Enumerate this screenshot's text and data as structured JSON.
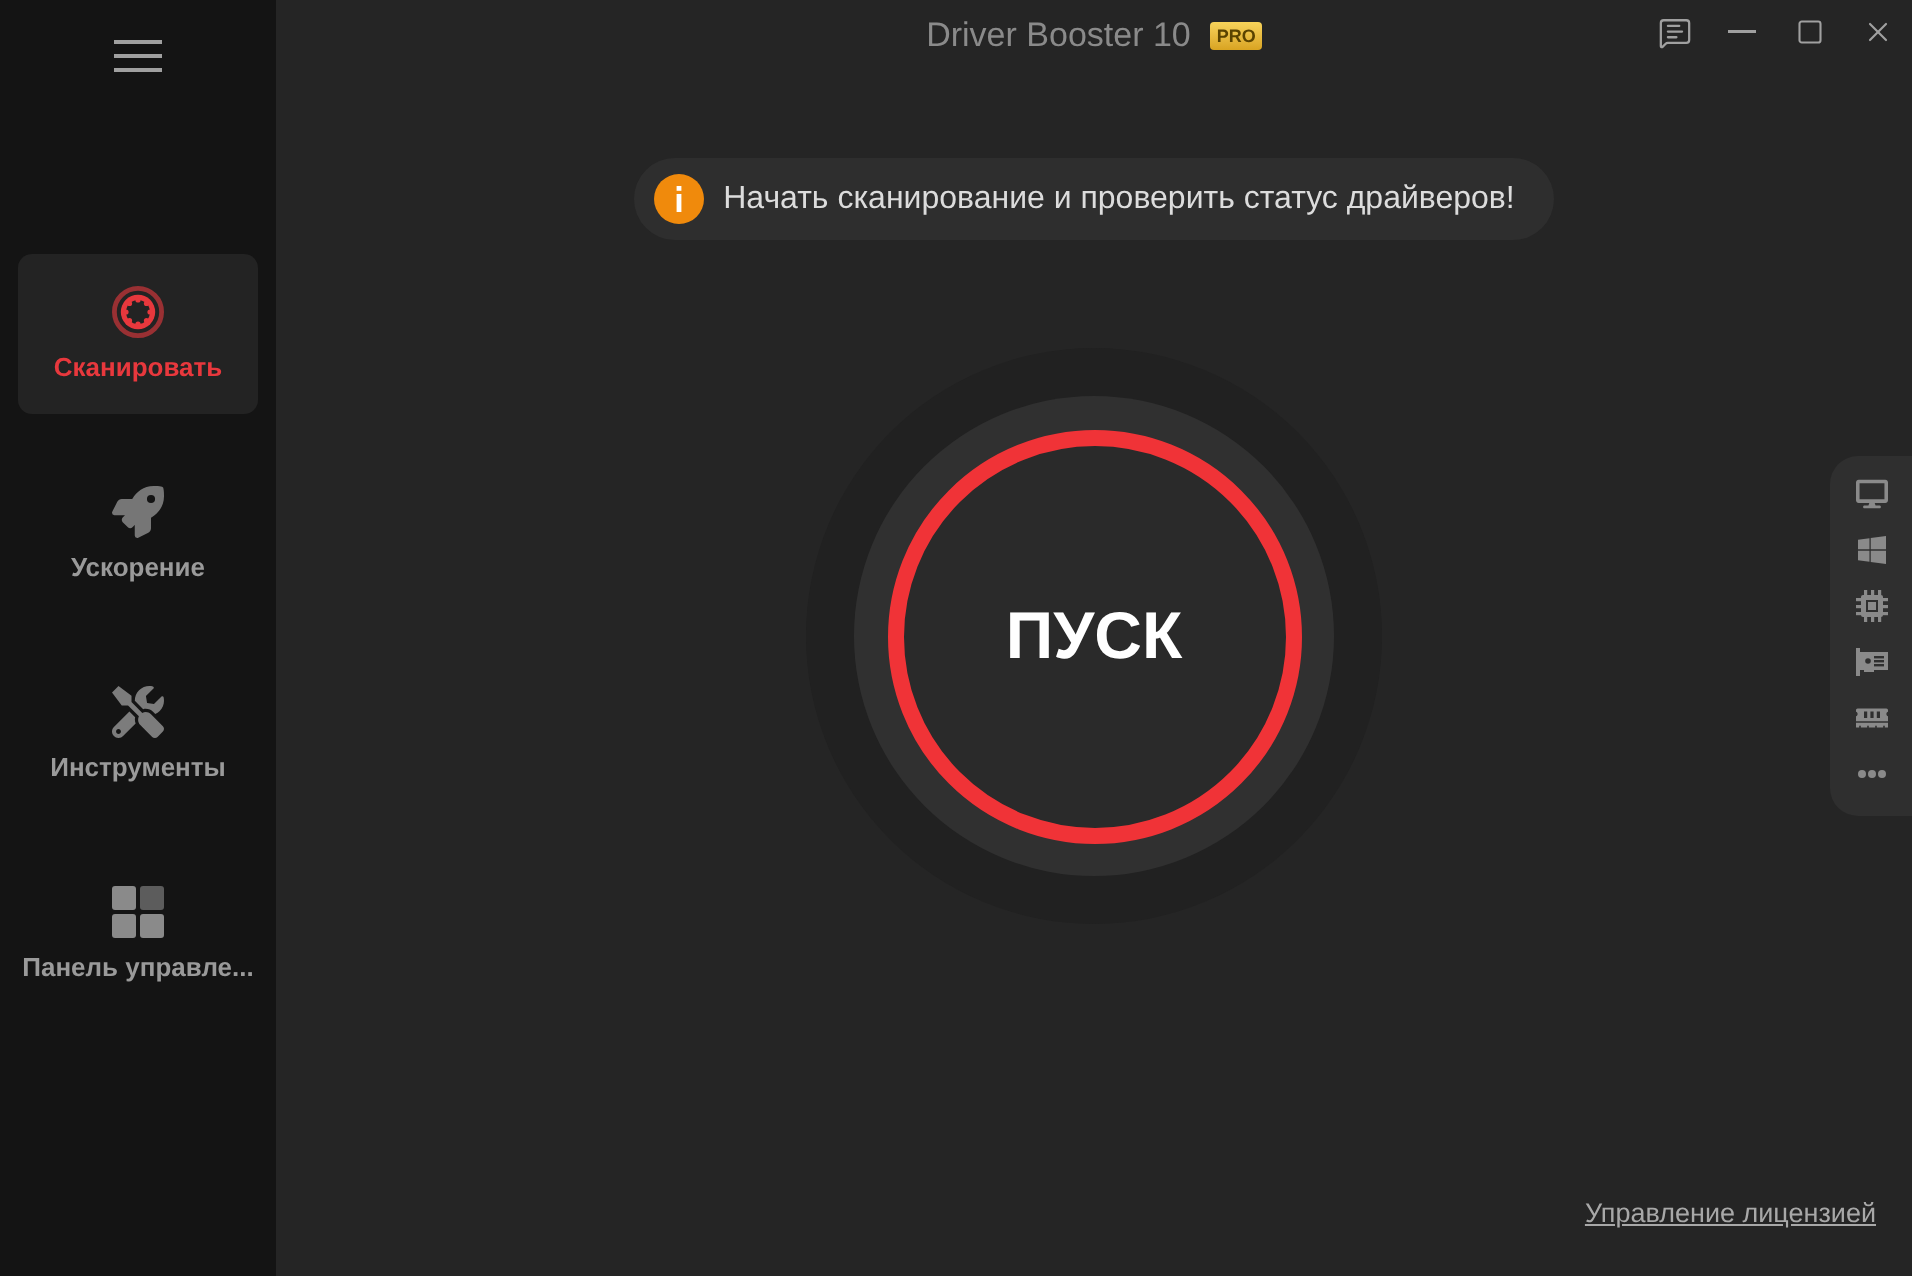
{
  "window": {
    "title": "Driver Booster 10",
    "badge": "PRO"
  },
  "sidebar": {
    "items": [
      {
        "kind": "scan",
        "label": "Сканировать",
        "selected": true
      },
      {
        "kind": "boost",
        "label": "Ускорение",
        "selected": false
      },
      {
        "kind": "tools",
        "label": "Инструменты",
        "selected": false
      },
      {
        "kind": "dashboard",
        "label": "Панель управле...",
        "selected": false
      }
    ]
  },
  "notice": {
    "text": "Начать сканирование и проверить статус драйверов!"
  },
  "start_button": {
    "label": "ПУСК"
  },
  "footer": {
    "link": "Управление лицензией"
  }
}
